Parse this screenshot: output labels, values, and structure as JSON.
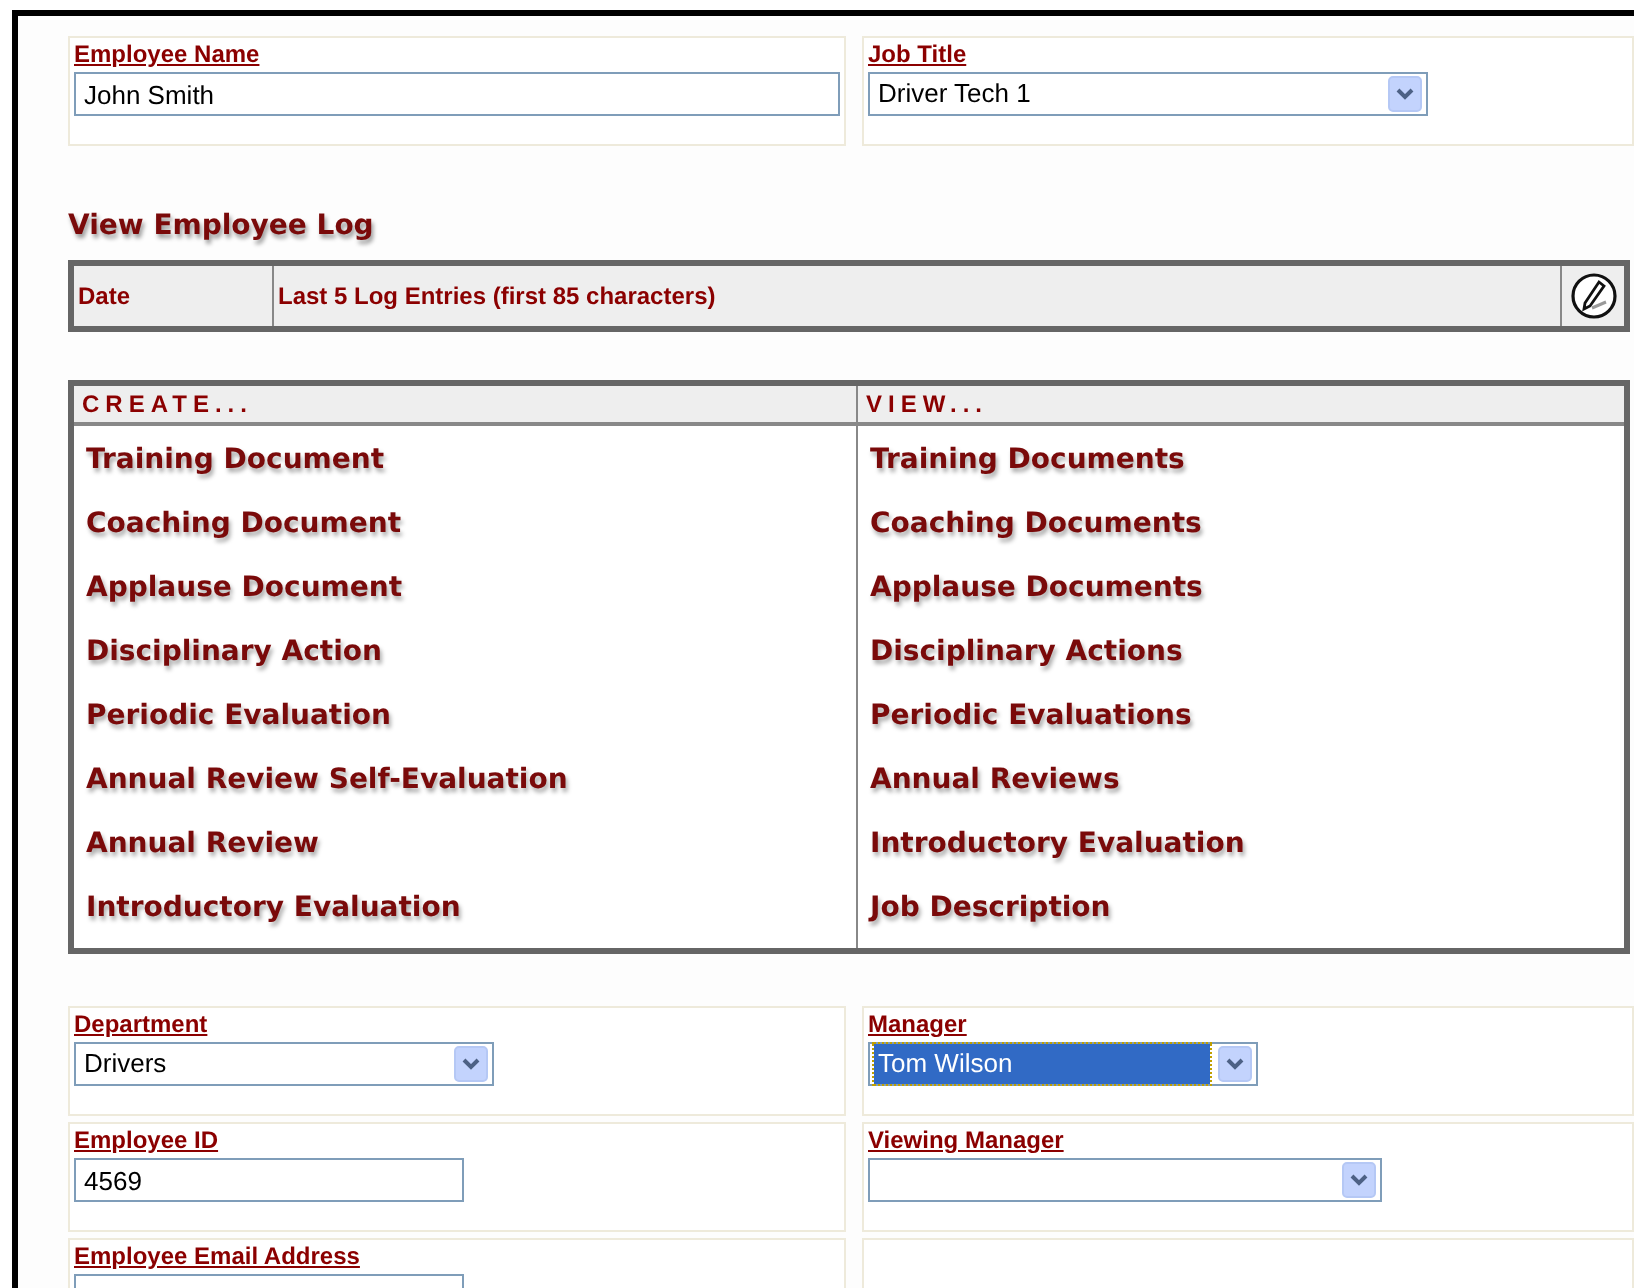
{
  "top_fields": [
    {
      "kind": "text",
      "label": "Employee Name",
      "value": "John Smith"
    },
    {
      "kind": "select",
      "label": "Job Title",
      "value": "Driver Tech 1",
      "focused": false
    }
  ],
  "log": {
    "heading": "View Employee Log",
    "columns": [
      "Date",
      "Last 5 Log Entries (first 85 characters)"
    ]
  },
  "actions": {
    "columns": [
      {
        "heading": "CREATE...",
        "links": [
          "Training Document",
          "Coaching Document",
          "Applause Document",
          "Disciplinary Action",
          "Periodic Evaluation",
          "Annual Review Self-Evaluation",
          "Annual Review",
          "Introductory Evaluation"
        ]
      },
      {
        "heading": "VIEW...",
        "links": [
          "Training Documents",
          "Coaching Documents",
          "Applause Documents",
          "Disciplinary Actions",
          "Periodic Evaluations",
          "Annual Reviews",
          "Introductory Evaluation",
          "Job Description"
        ]
      }
    ]
  },
  "bottom_fields": [
    {
      "kind": "select",
      "label": "Department",
      "value": "Drivers",
      "focused": false
    },
    {
      "kind": "select",
      "label": "Manager",
      "value": "Tom Wilson",
      "focused": true
    },
    {
      "kind": "text",
      "label": "Employee ID",
      "value": "4569"
    },
    {
      "kind": "select",
      "label": "Viewing Manager",
      "focused": false
    },
    {
      "kind": "text",
      "label": "Employee Email Address"
    },
    {
      "kind": "empty"
    }
  ]
}
